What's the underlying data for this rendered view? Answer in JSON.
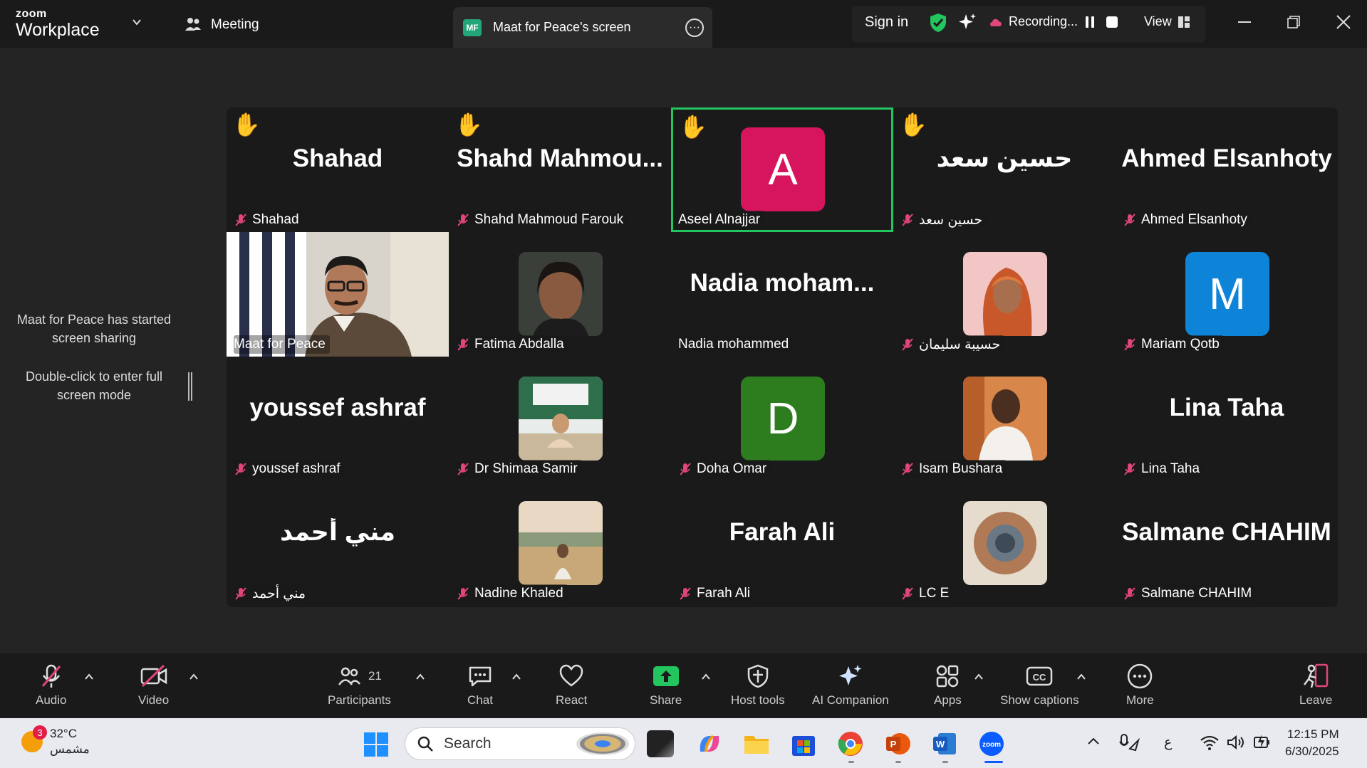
{
  "titlebar": {
    "brand_zoom": "zoom",
    "brand_product": "Workplace",
    "meeting_label": "Meeting",
    "tab_badge": "MF",
    "tab_title": "Maat for Peace's screen",
    "sign_in": "Sign in",
    "recording_label": "Recording...",
    "view_label": "View"
  },
  "sidebar": {
    "share_notice": "Maat for Peace has started screen sharing",
    "fullscreen_hint": "Double-click to enter full screen mode"
  },
  "colors": {
    "active_speaker_border": "#22c55e",
    "avatar_a": "#d6155e",
    "avatar_d": "#2d7d1f",
    "avatar_m": "#0e84d8",
    "mic_muted": "#e0457b",
    "share_green": "#22c55e"
  },
  "participants": [
    {
      "display": "Shahad",
      "label": "Shahad",
      "hand": true,
      "muted": true,
      "kind": "name"
    },
    {
      "display": "Shahd  Mahmou...",
      "label": "Shahd Mahmoud Farouk",
      "hand": true,
      "muted": true,
      "kind": "name"
    },
    {
      "display": "A",
      "label": "Aseel Alnajjar",
      "hand": true,
      "muted": false,
      "kind": "letter",
      "active": true
    },
    {
      "display": "حسين سعد",
      "label": "حسين سعد",
      "hand": true,
      "muted": true,
      "kind": "name"
    },
    {
      "display": "Ahmed Elsanhoty",
      "label": "Ahmed Elsanhoty",
      "hand": false,
      "muted": true,
      "kind": "name"
    },
    {
      "display": "",
      "label": "Maat for Peace",
      "hand": false,
      "muted": false,
      "kind": "video"
    },
    {
      "display": "",
      "label": "Fatima Abdalla",
      "hand": false,
      "muted": true,
      "kind": "photo"
    },
    {
      "display": "Nadia  moham...",
      "label": "Nadia mohammed",
      "hand": false,
      "muted": false,
      "kind": "name"
    },
    {
      "display": "",
      "label": "حسيبة سليمان",
      "hand": false,
      "muted": true,
      "kind": "photo"
    },
    {
      "display": "M",
      "label": "Mariam Qotb",
      "hand": false,
      "muted": true,
      "kind": "letter"
    },
    {
      "display": "youssef ashraf",
      "label": "youssef ashraf",
      "hand": false,
      "muted": true,
      "kind": "name"
    },
    {
      "display": "",
      "label": "Dr Shimaa Samir",
      "hand": false,
      "muted": true,
      "kind": "photo"
    },
    {
      "display": "D",
      "label": "Doha Omar",
      "hand": false,
      "muted": true,
      "kind": "letter"
    },
    {
      "display": "",
      "label": "Isam Bushara",
      "hand": false,
      "muted": true,
      "kind": "photo"
    },
    {
      "display": "Lina Taha",
      "label": "Lina Taha",
      "hand": false,
      "muted": true,
      "kind": "name"
    },
    {
      "display": "مني أحمد",
      "label": "مني أحمد",
      "hand": false,
      "muted": true,
      "kind": "name"
    },
    {
      "display": "",
      "label": "Nadine Khaled",
      "hand": false,
      "muted": true,
      "kind": "photo"
    },
    {
      "display": "Farah Ali",
      "label": "Farah Ali",
      "hand": false,
      "muted": true,
      "kind": "name"
    },
    {
      "display": "",
      "label": "LC E",
      "hand": false,
      "muted": true,
      "kind": "photo"
    },
    {
      "display": "Salmane CHAHIM",
      "label": "Salmane CHAHIM",
      "hand": false,
      "muted": true,
      "kind": "name"
    }
  ],
  "toolbar": {
    "audio": "Audio",
    "video": "Video",
    "participants": "Participants",
    "participants_count": "21",
    "chat": "Chat",
    "react": "React",
    "share": "Share",
    "host_tools": "Host tools",
    "ai_companion": "AI Companion",
    "apps": "Apps",
    "show_captions": "Show captions",
    "more": "More",
    "leave": "Leave"
  },
  "taskbar": {
    "weather_temp": "32°C",
    "weather_desc": "مشمس",
    "weather_badge": "3",
    "search_placeholder": "Search",
    "input_lang": "ع",
    "time": "12:15 PM",
    "date": "6/30/2025"
  }
}
